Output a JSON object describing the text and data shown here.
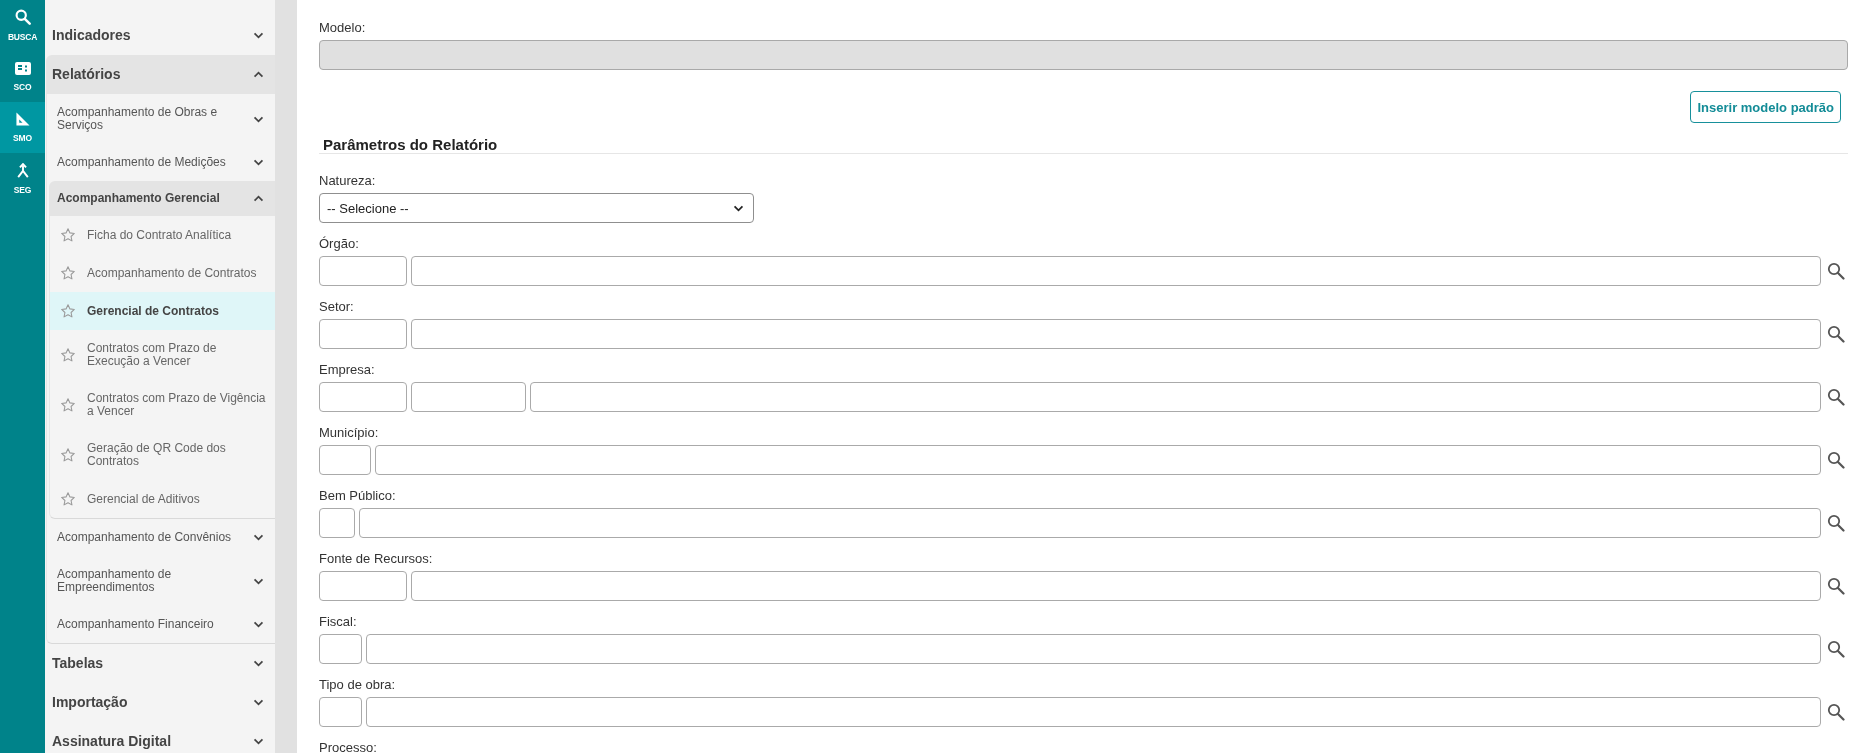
{
  "rail": [
    {
      "label": "BUSCA",
      "selected": false
    },
    {
      "label": "SCO",
      "selected": false
    },
    {
      "label": "SMO",
      "selected": true
    },
    {
      "label": "SEG",
      "selected": false
    }
  ],
  "sidebar": {
    "items": [
      {
        "label": "Indicadores",
        "expanded": false
      },
      {
        "label": "Relatórios",
        "expanded": true,
        "children": [
          {
            "label": "Acompanhamento de Obras e Serviços",
            "expanded": false
          },
          {
            "label": "Acompanhamento de Medições",
            "expanded": false
          },
          {
            "label": "Acompanhamento Gerencial",
            "expanded": true,
            "children": [
              {
                "label": "Ficha do Contrato Analítica",
                "selected": false,
                "favorite": false
              },
              {
                "label": "Acompanhamento de Contratos",
                "selected": false,
                "favorite": false
              },
              {
                "label": "Gerencial de Contratos",
                "selected": true,
                "favorite": false
              },
              {
                "label": "Contratos com Prazo de Execução a Vencer",
                "selected": false,
                "favorite": false
              },
              {
                "label": "Contratos com Prazo de Vigência a Vencer",
                "selected": false,
                "favorite": false
              },
              {
                "label": "Geração de QR Code dos Contratos",
                "selected": false,
                "favorite": false
              },
              {
                "label": "Gerencial de Aditivos",
                "selected": false,
                "favorite": false
              }
            ]
          },
          {
            "label": "Acompanhamento de Convênios",
            "expanded": false
          },
          {
            "label": "Acompanhamento de Empreendimentos",
            "expanded": false
          },
          {
            "label": "Acompanhamento Financeiro",
            "expanded": false
          }
        ]
      },
      {
        "label": "Tabelas",
        "expanded": false
      },
      {
        "label": "Importação",
        "expanded": false
      },
      {
        "label": "Assinatura Digital",
        "expanded": false
      }
    ]
  },
  "form": {
    "model": {
      "label": "Modelo:",
      "disabled": true
    },
    "default_button": "Inserir modelo padrão",
    "section_title": "Parâmetros do Relatório",
    "fields": [
      {
        "kind": "select",
        "label": "Natureza:",
        "value": "-- Selecione --"
      },
      {
        "kind": "lookup",
        "label": "Órgão:"
      },
      {
        "kind": "lookup",
        "label": "Setor:"
      },
      {
        "kind": "double-lookup",
        "label": "Empresa:"
      },
      {
        "kind": "lookup",
        "label": "Município:"
      },
      {
        "kind": "lookup",
        "label": "Bem Público:"
      },
      {
        "kind": "lookup",
        "label": "Fonte de Recursos:"
      },
      {
        "kind": "lookup",
        "label": "Fiscal:"
      },
      {
        "kind": "lookup",
        "label": "Tipo de obra:"
      },
      {
        "label": "Processo:"
      }
    ]
  }
}
